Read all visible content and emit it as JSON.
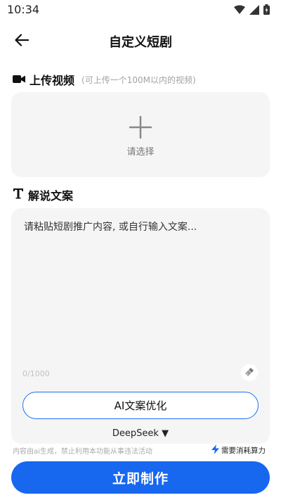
{
  "status_bar": {
    "time": "10:34"
  },
  "header": {
    "title": "自定义短剧"
  },
  "upload_section": {
    "title": "上传视频",
    "hint": "(可上传一个100M以内的视频)",
    "select_label": "请选择"
  },
  "script_section": {
    "title": "解说文案",
    "placeholder": "请粘贴短剧推广内容, 或自行输入文案...",
    "char_count": "0/1000",
    "ai_optimize_label": "AI文案优化",
    "model_label": "DeepSeek ▼"
  },
  "footer": {
    "disclaimer": "内容由ai生成，禁止利用本功能从事违法活动",
    "cost_note": "需要消耗算力"
  },
  "submit": {
    "label": "立即制作"
  },
  "colors": {
    "accent": "#1767ef",
    "panel": "#f5f5f5"
  }
}
